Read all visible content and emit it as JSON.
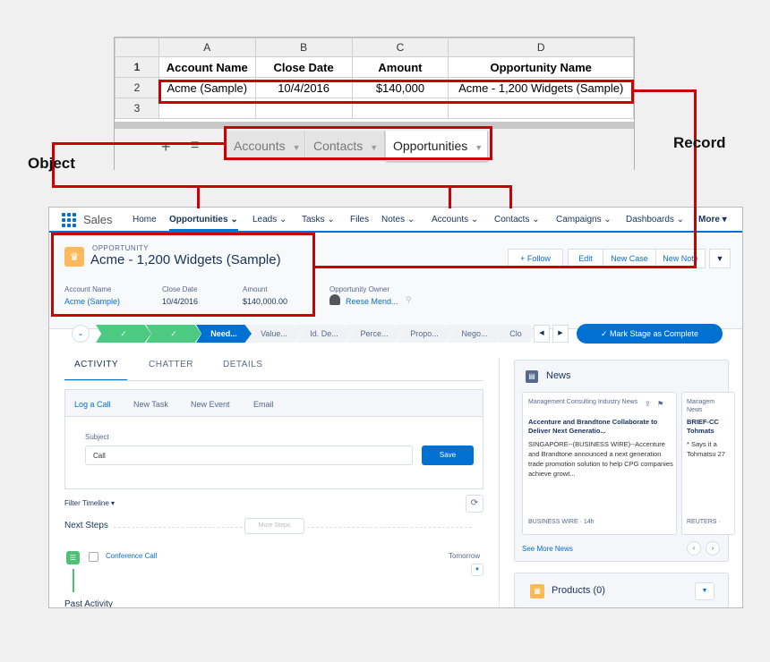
{
  "sheet": {
    "col_headers": [
      "A",
      "B",
      "C",
      "D"
    ],
    "row_numbers": [
      "1",
      "2",
      "3"
    ],
    "header_row": [
      "Account Name",
      "Close Date",
      "Amount",
      "Opportunity Name"
    ],
    "data_row": [
      "Acme (Sample)",
      "10/4/2016",
      "$140,000",
      "Acme - 1,200 Widgets (Sample)"
    ],
    "add_glyph": "+",
    "tabs": [
      "Accounts",
      "Contacts",
      "Opportunities"
    ]
  },
  "annotations": {
    "object_label": "Object",
    "record_label": "Record"
  },
  "nav": {
    "app_name": "Sales",
    "items": [
      "Home",
      "Opportunities",
      "Leads",
      "Tasks",
      "Files",
      "Notes",
      "Accounts",
      "Contacts",
      "Campaigns",
      "Dashboards",
      "More"
    ]
  },
  "record": {
    "object_type": "OPPORTUNITY",
    "title": "Acme - 1,200 Widgets (Sample)",
    "actions": [
      "+ Follow",
      "Edit",
      "New Case",
      "New Note"
    ],
    "fields": [
      {
        "label": "Account Name",
        "value": "Acme (Sample)"
      },
      {
        "label": "Close Date",
        "value": "10/4/2016"
      },
      {
        "label": "Amount",
        "value": "$140,000.00"
      },
      {
        "label": "Opportunity Owner",
        "value": "Reese Mend..."
      }
    ]
  },
  "path": {
    "stages": [
      "",
      "",
      "Need...",
      "Value...",
      "Id. De...",
      "Perce...",
      "Propo...",
      "Nego...",
      "Clo"
    ],
    "mark_complete": "✓  Mark Stage as Complete"
  },
  "tabs": [
    "ACTIVITY",
    "CHATTER",
    "DETAILS"
  ],
  "publisher": {
    "tabs": [
      "Log a Call",
      "New Task",
      "New Event",
      "Email"
    ],
    "subject_label": "Subject",
    "subject_value": "Call",
    "save_label": "Save"
  },
  "timeline": {
    "filter_label": "Filter Timeline",
    "next_steps": "Next Steps",
    "more_steps": "More Steps",
    "task_label": "Conference Call",
    "task_due": "Tomorrow",
    "past_activity": "Past Activity"
  },
  "news": {
    "title": "News",
    "cards": [
      {
        "source_category": "Management Consulting Industry News",
        "headline": "Accenture and Brandtone Collaborate to Deliver Next Generatio...",
        "body": "SINGAPORE--(BUSINESS WIRE)--Accenture and Brandtone announced a next generation trade promotion solution to help CPG companies achieve growt...",
        "source": "BUSINESS WIRE · 14h"
      },
      {
        "source_category": "Managem News",
        "headline": "BRIEF-CC Tohmats",
        "body": "* Says it a Tohmatsu 27",
        "source": "REUTERS ·"
      }
    ],
    "see_more": "See More News"
  },
  "products": {
    "title": "Products (0)"
  }
}
